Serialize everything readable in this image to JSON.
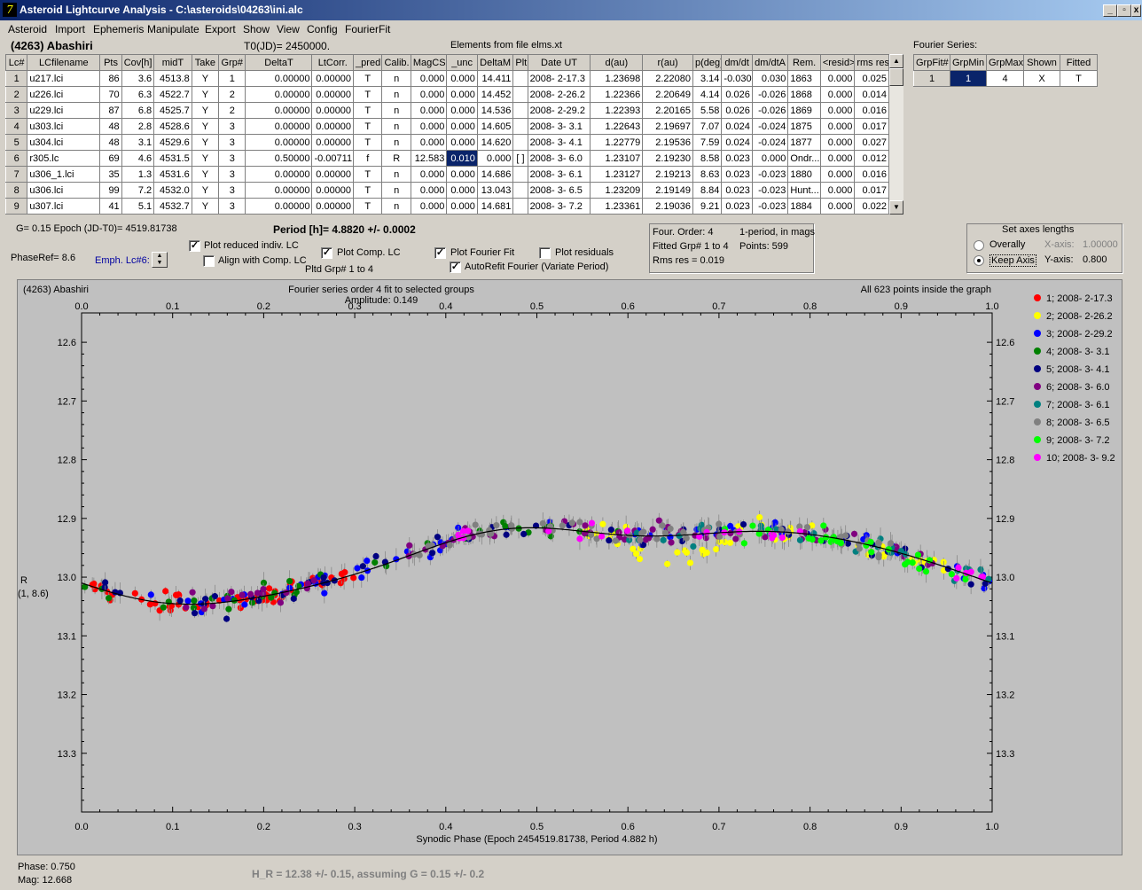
{
  "window": {
    "title": "Asteroid Lightcurve Analysis - C:\\asteroids\\04263\\ini.alc",
    "icon": "app-logo-icon",
    "buttons": [
      "_",
      "▫",
      "x"
    ]
  },
  "menu": [
    "Asteroid",
    "Import",
    "Ephemeris",
    "Manipulate",
    "Export",
    "Show",
    "View",
    "Config",
    "FourierFit"
  ],
  "header": {
    "asteroid": "(4263) Abashiri",
    "t0": "T0(JD)= 2450000.",
    "elements": "Elements from file elms.xt"
  },
  "lc_table": {
    "columns": [
      "Lc#",
      "LCfilename",
      "Pts",
      "Cov[h]",
      "midT",
      "Take",
      "Grp#",
      "DeltaT",
      "LtCorr.",
      "_pred",
      "Calib.",
      "MagCS",
      "_unc",
      "DeltaM",
      "Plt",
      "Date UT",
      "d(au)",
      "r(au)",
      "p(deg)",
      "dm/dt",
      "dm/dtA",
      "Rem.",
      "<resid>",
      "rms res"
    ],
    "rows": [
      [
        "1",
        "u217.lci",
        "86",
        "3.6",
        "4513.8",
        "Y",
        "1",
        "0.00000",
        "0.00000",
        "T",
        "n",
        "0.000",
        "0.000",
        "14.411",
        "",
        "2008- 2-17.3",
        "1.23698",
        "2.22080",
        "3.14",
        "-0.030",
        "0.030",
        "1863",
        "0.000",
        "0.025"
      ],
      [
        "2",
        "u226.lci",
        "70",
        "6.3",
        "4522.7",
        "Y",
        "2",
        "0.00000",
        "0.00000",
        "T",
        "n",
        "0.000",
        "0.000",
        "14.452",
        "",
        "2008- 2-26.2",
        "1.22366",
        "2.20649",
        "4.14",
        "0.026",
        "-0.026",
        "1868",
        "0.000",
        "0.014"
      ],
      [
        "3",
        "u229.lci",
        "87",
        "6.8",
        "4525.7",
        "Y",
        "2",
        "0.00000",
        "0.00000",
        "T",
        "n",
        "0.000",
        "0.000",
        "14.536",
        "",
        "2008- 2-29.2",
        "1.22393",
        "2.20165",
        "5.58",
        "0.026",
        "-0.026",
        "1869",
        "0.000",
        "0.016"
      ],
      [
        "4",
        "u303.lci",
        "48",
        "2.8",
        "4528.6",
        "Y",
        "3",
        "0.00000",
        "0.00000",
        "T",
        "n",
        "0.000",
        "0.000",
        "14.605",
        "",
        "2008- 3- 3.1",
        "1.22643",
        "2.19697",
        "7.07",
        "0.024",
        "-0.024",
        "1875",
        "0.000",
        "0.017"
      ],
      [
        "5",
        "u304.lci",
        "48",
        "3.1",
        "4529.6",
        "Y",
        "3",
        "0.00000",
        "0.00000",
        "T",
        "n",
        "0.000",
        "0.000",
        "14.620",
        "",
        "2008- 3- 4.1",
        "1.22779",
        "2.19536",
        "7.59",
        "0.024",
        "-0.024",
        "1877",
        "0.000",
        "0.027"
      ],
      [
        "6",
        "r305.lc",
        "69",
        "4.6",
        "4531.5",
        "Y",
        "3",
        "0.50000",
        "-0.00711",
        "f",
        "R",
        "12.583",
        "0.010",
        "0.000",
        "[ ]",
        "2008- 3- 6.0",
        "1.23107",
        "2.19230",
        "8.58",
        "0.023",
        "0.000",
        "Ondr...",
        "0.000",
        "0.012"
      ],
      [
        "7",
        "u306_1.lci",
        "35",
        "1.3",
        "4531.6",
        "Y",
        "3",
        "0.00000",
        "0.00000",
        "T",
        "n",
        "0.000",
        "0.000",
        "14.686",
        "",
        "2008- 3- 6.1",
        "1.23127",
        "2.19213",
        "8.63",
        "0.023",
        "-0.023",
        "1880",
        "0.000",
        "0.016"
      ],
      [
        "8",
        "u306.lci",
        "99",
        "7.2",
        "4532.0",
        "Y",
        "3",
        "0.00000",
        "0.00000",
        "T",
        "n",
        "0.000",
        "0.000",
        "13.043",
        "",
        "2008- 3- 6.5",
        "1.23209",
        "2.19149",
        "8.84",
        "0.023",
        "-0.023",
        "Hunt...",
        "0.000",
        "0.017"
      ],
      [
        "9",
        "u307.lci",
        "41",
        "5.1",
        "4532.7",
        "Y",
        "3",
        "0.00000",
        "0.00000",
        "T",
        "n",
        "0.000",
        "0.000",
        "14.681",
        "",
        "2008- 3- 7.2",
        "1.23361",
        "2.19036",
        "9.21",
        "0.023",
        "-0.023",
        "1884",
        "0.000",
        "0.022"
      ]
    ]
  },
  "fourier_series": {
    "label": "Fourier Series:",
    "columns": [
      "GrpFit#",
      "GrpMin",
      "GrpMax",
      "Shown",
      "Fitted"
    ],
    "row": [
      "1",
      "1",
      "4",
      "X",
      "T"
    ]
  },
  "controls": {
    "g_line": "G= 0.15   Epoch (JD-T0)= 4519.81738",
    "period": "Period [h]= 4.8820 +/- 0.0002",
    "phaseref": "PhaseRef= 8.6",
    "emph": "Emph. Lc#6:",
    "plot_reduced": "Plot reduced indiv. LC",
    "align_comp": "Align with Comp. LC",
    "plot_comp": "Plot Comp. LC",
    "pltd_grp": "Pltd Grp#  1   to   4",
    "plot_fourier": "Plot Fourier Fit",
    "autorefit": "AutoRefit Fourier (Variate Period)",
    "plot_residuals": "Plot residuals"
  },
  "fit_info": {
    "order": "Four. Order:  4",
    "period_mode": "1-period, in mags",
    "fitted_grp": "Fitted Grp# 1 to 4",
    "points": "Points: 599",
    "rms": "Rms res     = 0.019"
  },
  "axes_box": {
    "title": "Set axes lengths",
    "overally": "Overally",
    "keep_axis": "Keep Axis",
    "xaxis_label": "X-axis:",
    "xaxis_value": "1.00000",
    "yaxis_label": "Y-axis:",
    "yaxis_value": "0.800"
  },
  "chart_titles": {
    "object": "(4263) Abashiri",
    "fourier": "Fourier series order 4 fit to selected groups",
    "amplitude": "Amplitude: 0.149",
    "points_inside": "All 623 points inside the graph",
    "ylabel1": "R",
    "ylabel2": "(1, 8.6)"
  },
  "chart_data": {
    "type": "scatter",
    "xlabel": "Synodic Phase (Epoch 2454519.81738, Period 4.882 h)",
    "xlim": [
      0,
      1
    ],
    "ylim": [
      13.4,
      12.55
    ],
    "xticks": [
      "0.0",
      "0.1",
      "0.2",
      "0.3",
      "0.4",
      "0.5",
      "0.6",
      "0.7",
      "0.8",
      "0.9",
      "1.0"
    ],
    "yticks": [
      "12.6",
      "12.7",
      "12.8",
      "12.9",
      "13.0",
      "13.1",
      "13.2",
      "13.3"
    ],
    "fourier_fit": {
      "mean": 12.968,
      "terms": [
        [
          0.043,
          0.045
        ],
        [
          -0.003,
          0.018
        ],
        [
          0.004,
          -0.002
        ],
        [
          -0.002,
          0.002
        ]
      ]
    },
    "series": [
      {
        "name": "1; 2008- 2-17.3",
        "color": "#ff0000"
      },
      {
        "name": "2; 2008- 2-26.2",
        "color": "#ffff00"
      },
      {
        "name": "3; 2008- 2-29.2",
        "color": "#0000ff"
      },
      {
        "name": "4; 2008- 3- 3.1",
        "color": "#008000"
      },
      {
        "name": "5; 2008- 3- 4.1",
        "color": "#000080"
      },
      {
        "name": "6; 2008- 3- 6.0",
        "color": "#800080"
      },
      {
        "name": "7; 2008- 3- 6.1",
        "color": "#008080"
      },
      {
        "name": "8; 2008- 3- 6.5",
        "color": "#808080"
      },
      {
        "name": "9; 2008- 3- 7.2",
        "color": "#00ff00"
      },
      {
        "name": "10; 2008- 3- 9.2",
        "color": "#ff00ff"
      }
    ]
  },
  "status": {
    "phase": "Phase:  0.750",
    "mag": "Mag:   12.668",
    "hr": "H_R = 12.38 +/- 0.15, assuming G = 0.15 +/- 0.2"
  }
}
